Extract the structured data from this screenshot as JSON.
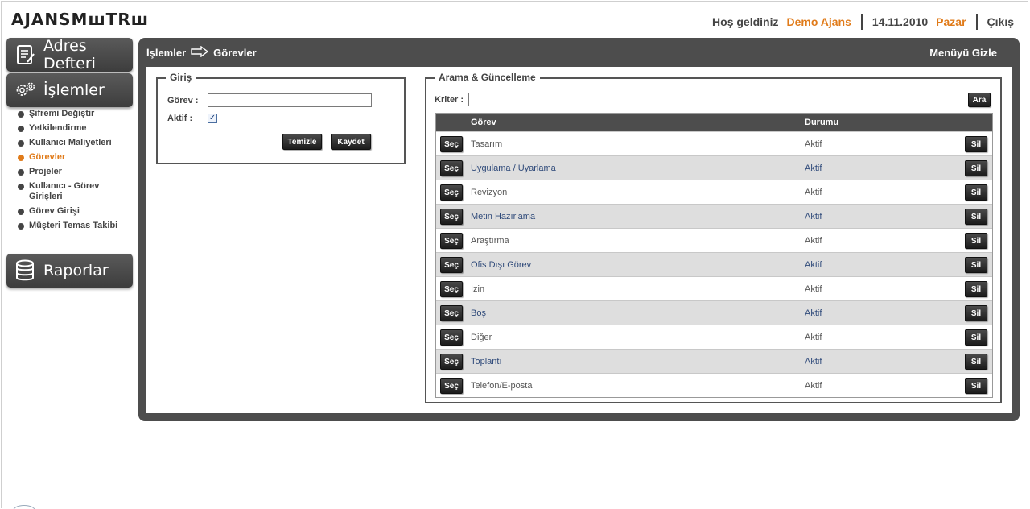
{
  "header": {
    "logo": "AJANSMꟺTRꟺ",
    "welcome": "Hoş geldiniz",
    "user": "Demo Ajans",
    "date": "14.11.2010",
    "day": "Pazar",
    "logout": "Çıkış",
    "accent_color": "#e07b1a"
  },
  "sidebar": {
    "adres": {
      "label": "Adres Defteri",
      "icon": "address-book-icon"
    },
    "islemler": {
      "label": "İşlemler",
      "icon": "gears-icon"
    },
    "items": [
      {
        "label": "Şifremi Değiştir",
        "active": false
      },
      {
        "label": "Yetkilendirme",
        "active": false
      },
      {
        "label": "Kullanıcı Maliyetleri",
        "active": false
      },
      {
        "label": "Görevler",
        "active": true
      },
      {
        "label": "Projeler",
        "active": false
      },
      {
        "label": "Kullanıcı - Görev Girişleri",
        "active": false
      },
      {
        "label": "Görev Girişi",
        "active": false
      },
      {
        "label": "Müşteri Temas Takibi",
        "active": false
      }
    ],
    "raporlar": {
      "label": "Raporlar",
      "icon": "database-icon"
    }
  },
  "panel": {
    "breadcrumb_root": "İşlemler",
    "breadcrumb_current": "Görevler",
    "hide_menu": "Menüyü Gizle"
  },
  "giris": {
    "legend": "Giriş",
    "gorev_label": "Görev  :",
    "gorev_value": "",
    "aktif_label": "Aktif    :",
    "aktif_checked": true,
    "clear_label": "Temizle",
    "save_label": "Kaydet"
  },
  "arama": {
    "legend": "Arama & Güncelleme",
    "kriter_label": "Kriter :",
    "kriter_value": "",
    "search_label": "Ara",
    "columns": {
      "gorev": "Görev",
      "durum": "Durumu"
    },
    "select_label": "Seç",
    "delete_label": "Sil",
    "rows": [
      {
        "gorev": "Tasarım",
        "durum": "Aktif"
      },
      {
        "gorev": "Uygulama / Uyarlama",
        "durum": "Aktif"
      },
      {
        "gorev": "Revizyon",
        "durum": "Aktif"
      },
      {
        "gorev": "Metin Hazırlama",
        "durum": "Aktif"
      },
      {
        "gorev": "Araştırma",
        "durum": "Aktif"
      },
      {
        "gorev": "Ofis Dışı Görev",
        "durum": "Aktif"
      },
      {
        "gorev": "İzin",
        "durum": "Aktif"
      },
      {
        "gorev": "Boş",
        "durum": "Aktif"
      },
      {
        "gorev": "Diğer",
        "durum": "Aktif"
      },
      {
        "gorev": "Toplantı",
        "durum": "Aktif"
      },
      {
        "gorev": "Telefon/E-posta",
        "durum": "Aktif"
      }
    ]
  }
}
